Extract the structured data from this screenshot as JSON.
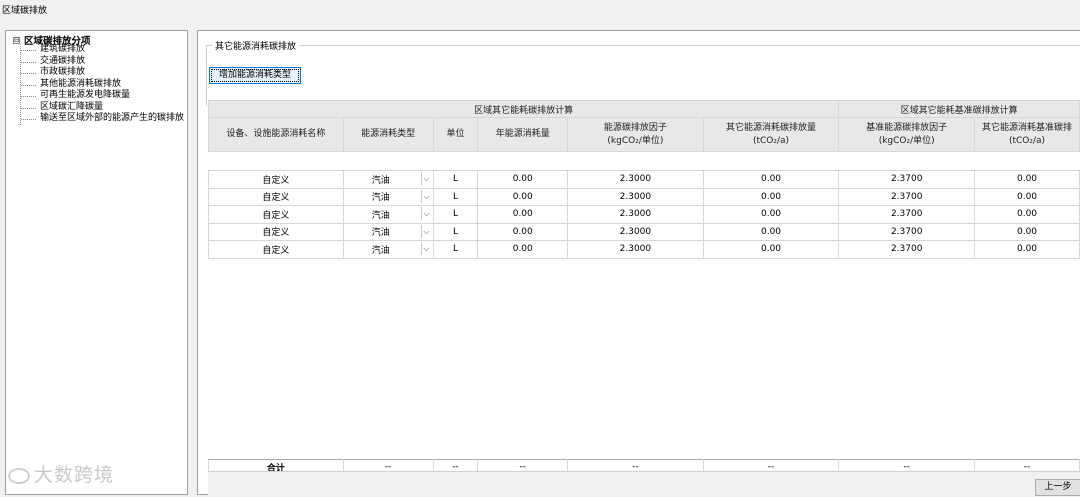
{
  "window": {
    "title": "区域碳排放"
  },
  "tree": {
    "root_label": "区域碳排放分项",
    "expander": "⊟",
    "items": [
      "建筑碳排放",
      "交通碳排放",
      "市政碳排放",
      "其他能源消耗碳排放",
      "可再生能源发电降碳量",
      "区域碳汇降碳量",
      "输送至区域外部的能源产生的碳排放"
    ]
  },
  "watermark": "大数跨境",
  "panel": {
    "group_title": "其它能源消耗碳排放",
    "add_button": "增加能源消耗类型"
  },
  "table": {
    "group_headers": [
      "区域其它能耗碳排放计算",
      "区域其它能耗基准碳排放计算"
    ],
    "columns": [
      {
        "line1": "设备、设施能源消耗名称",
        "line2": ""
      },
      {
        "line1": "能源消耗类型",
        "line2": ""
      },
      {
        "line1": "单位",
        "line2": ""
      },
      {
        "line1": "年能源消耗量",
        "line2": ""
      },
      {
        "line1": "能源碳排放因子",
        "line2": "(kgCO₂/单位)"
      },
      {
        "line1": "其它能源消耗碳排放量",
        "line2": "(tCO₂/a)"
      },
      {
        "line1": "基准能源碳排放因子",
        "line2": "(kgCO₂/单位)"
      },
      {
        "line1": "其它能源消耗基准碳排",
        "line2": "(tCO₂/a)"
      }
    ],
    "rows": [
      [
        "自定义",
        "汽油",
        "L",
        "0.00",
        "2.3000",
        "0.00",
        "2.3700",
        "0.00"
      ],
      [
        "自定义",
        "汽油",
        "L",
        "0.00",
        "2.3000",
        "0.00",
        "2.3700",
        "0.00"
      ],
      [
        "自定义",
        "汽油",
        "L",
        "0.00",
        "2.3000",
        "0.00",
        "2.3700",
        "0.00"
      ],
      [
        "自定义",
        "汽油",
        "L",
        "0.00",
        "2.3000",
        "0.00",
        "2.3700",
        "0.00"
      ],
      [
        "自定义",
        "汽油",
        "L",
        "0.00",
        "2.3000",
        "0.00",
        "2.3700",
        "0.00"
      ]
    ],
    "total": [
      "合计",
      "--",
      "--",
      "--",
      "--",
      "--",
      "--",
      "--"
    ]
  },
  "footer": {
    "prev_button": "上一步"
  }
}
